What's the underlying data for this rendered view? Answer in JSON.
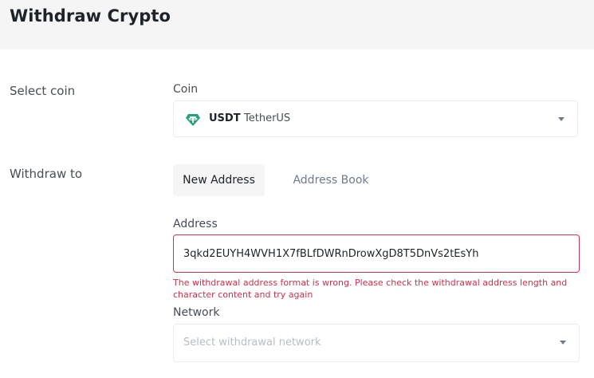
{
  "header": {
    "title": "Withdraw Crypto"
  },
  "select_coin": {
    "row_label": "Select coin",
    "field_label": "Coin",
    "selected": {
      "symbol": "USDT",
      "name": "TetherUS",
      "icon": "tether-icon",
      "icon_color": "#26a17b"
    }
  },
  "withdraw_to": {
    "row_label": "Withdraw to",
    "tabs": [
      {
        "label": "New Address",
        "active": true
      },
      {
        "label": "Address Book",
        "active": false
      }
    ],
    "address": {
      "label": "Address",
      "value": "3qkd2EUYH4WVH1X7fBLfDWRnDrowXgD8T5DnVs2tEsYh",
      "error": "The withdrawal address format is wrong. Please check the withdrawal address length and character content and try again",
      "error_color": "#cf304a"
    },
    "network": {
      "label": "Network",
      "placeholder": "Select withdrawal network"
    }
  }
}
